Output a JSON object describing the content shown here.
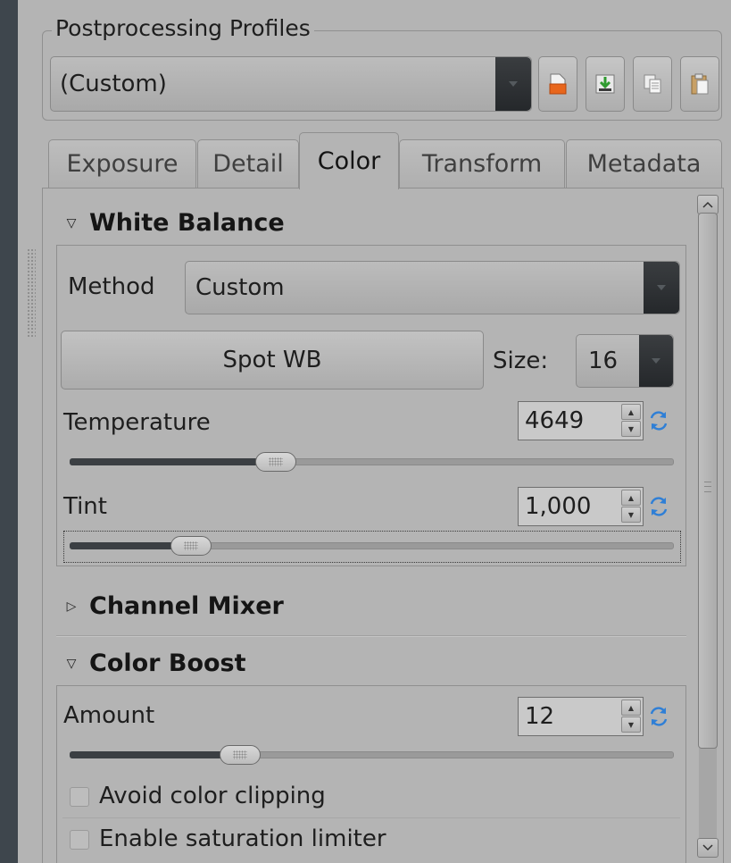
{
  "profiles": {
    "title": "Postprocessing Profiles",
    "selected": "(Custom)"
  },
  "tabs": [
    {
      "label": "Exposure",
      "active": false
    },
    {
      "label": "Detail",
      "active": false
    },
    {
      "label": "Color",
      "active": true
    },
    {
      "label": "Transform",
      "active": false
    },
    {
      "label": "Metadata",
      "active": false
    }
  ],
  "white_balance": {
    "title": "White Balance",
    "method_label": "Method",
    "method_value": "Custom",
    "spot_button": "Spot WB",
    "size_label": "Size:",
    "size_value": "16",
    "temperature_label": "Temperature",
    "temperature_value": "4649",
    "temperature_slider_fraction": 0.34,
    "tint_label": "Tint",
    "tint_value": "1,000",
    "tint_slider_fraction": 0.2
  },
  "channel_mixer": {
    "title": "Channel Mixer"
  },
  "color_boost": {
    "title": "Color Boost",
    "amount_label": "Amount",
    "amount_value": "12",
    "amount_slider_fraction": 0.28,
    "avoid_clipping_label": "Avoid color clipping",
    "saturation_limiter_label": "Enable saturation limiter"
  },
  "colors": {
    "panel_bg": "#b4b4b4",
    "slider_fill": "#3b3f43",
    "reset_icon": "#2f7fd6"
  }
}
